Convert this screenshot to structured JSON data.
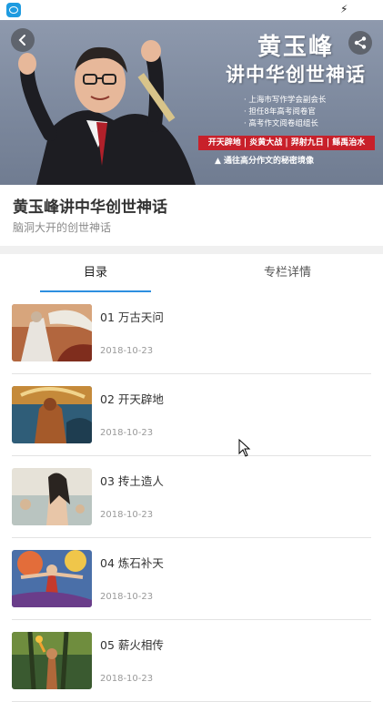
{
  "status_bar": {
    "app_icon": "app-icon",
    "indicator_icon": "bolt-icon"
  },
  "banner": {
    "title_line1": "黄玉峰",
    "title_line2": "讲中华创世神话",
    "credentials": [
      "上海市写作学会副会长",
      "担任8年高考阅卷官",
      "高考作文阅卷组组长"
    ],
    "topics": "开天辟地 | 炎黄大战 | 羿射九日 | 鲧禹治水",
    "tagline": "▲ 通往高分作文的秘密境像",
    "back_icon": "chevron-left-icon",
    "share_icon": "share-icon"
  },
  "course": {
    "title": "黄玉峰讲中华创世神话",
    "subtitle": "脑洞大开的创世神话"
  },
  "tabs": [
    {
      "label": "目录",
      "active": true
    },
    {
      "label": "专栏详情",
      "active": false
    }
  ],
  "episodes": [
    {
      "title": "01 万古天问",
      "date": "2018-10-23"
    },
    {
      "title": "02 开天辟地",
      "date": "2018-10-23"
    },
    {
      "title": "03 抟土造人",
      "date": "2018-10-23"
    },
    {
      "title": "04 炼石补天",
      "date": "2018-10-23"
    },
    {
      "title": "05 薪火相传",
      "date": "2018-10-23"
    }
  ],
  "colors": {
    "accent": "#2d8fe0",
    "banner_red": "#c8202a",
    "banner_bg": "#7b879c"
  }
}
